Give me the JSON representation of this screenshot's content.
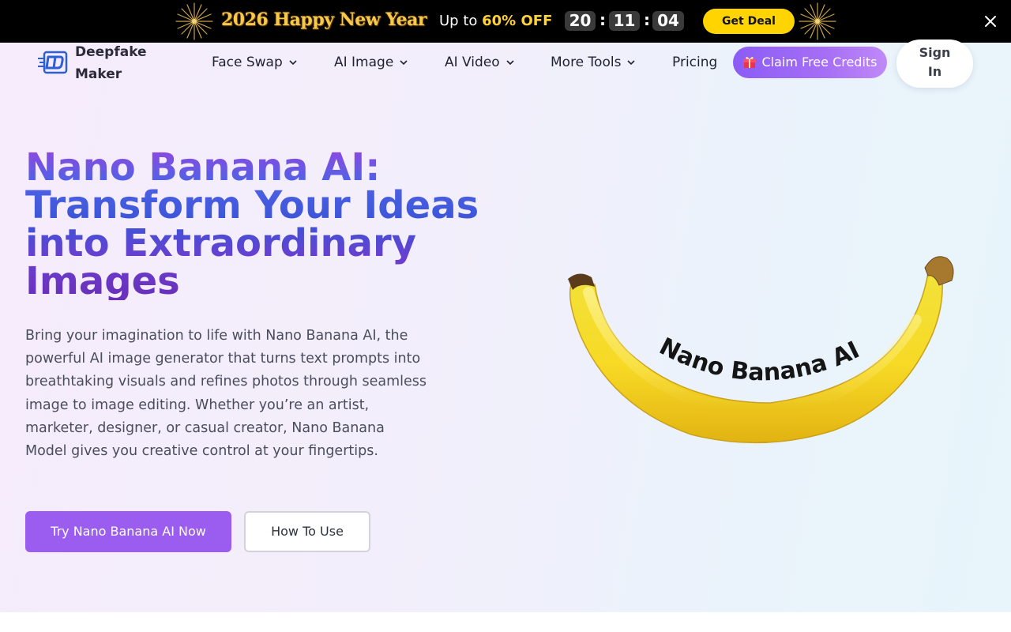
{
  "promo": {
    "title": "2026 Happy New Year",
    "offer_prefix": "Up to ",
    "offer_percent": "60% OFF",
    "countdown": [
      "20",
      "11",
      "04"
    ],
    "separator": ":",
    "deal_label": "Get Deal",
    "close_icon": "close-icon",
    "decor_icon": "firework-icon"
  },
  "header": {
    "logo_text": "Deepfake Maker",
    "logo_icon": "deepfake-maker-logo-icon",
    "nav": [
      {
        "label": "Face Swap",
        "dropdown": true
      },
      {
        "label": "AI Image",
        "dropdown": true
      },
      {
        "label": "AI Video",
        "dropdown": true
      },
      {
        "label": "More Tools",
        "dropdown": true
      },
      {
        "label": "Pricing",
        "dropdown": false
      }
    ],
    "claim_label": "Claim Free Credits",
    "claim_icon": "gift-icon",
    "signin_label": "Sign In"
  },
  "hero": {
    "title": "Nano Banana AI: Transform Your Ideas into Extraordinary Images",
    "description": "Bring your imagination to life with Nano Banana AI, the powerful AI image generator that turns text prompts into breathtaking visuals and refines photos through seamless image to image editing. Whether you’re an artist, marketer, designer, or casual creator, Nano Banana Model gives you creative control at your fingertips.",
    "primary_label": "Try Nano Banana AI Now",
    "secondary_label": "How To Use",
    "image_caption": "Nano Banana AI"
  },
  "colors": {
    "promo_bg": "#000000",
    "deal_button": "#ffd400",
    "accent_purple": "#9b5cf0",
    "title_gradient": [
      "#9147e0",
      "#3b55d8",
      "#6a2fb8"
    ]
  }
}
